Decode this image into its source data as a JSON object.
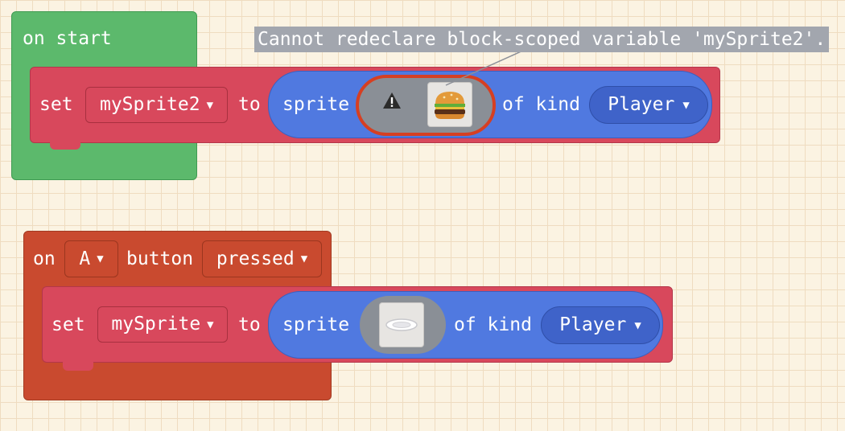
{
  "tooltip": {
    "text": "Cannot redeclare block-scoped variable 'mySprite2'."
  },
  "block_on_start": {
    "label": "on start",
    "set": {
      "keyword": "set",
      "variable": "mySprite2",
      "to": "to",
      "sprite": "sprite",
      "image_icon": "hamburger-sprite-icon",
      "warning_icon": "warning-icon",
      "of_kind": "of kind",
      "kind": "Player"
    }
  },
  "block_on_button": {
    "on": "on",
    "button": "A",
    "button_word": "button",
    "event": "pressed",
    "set": {
      "keyword": "set",
      "variable": "mySprite",
      "to": "to",
      "sprite": "sprite",
      "image_icon": "plate-sprite-icon",
      "of_kind": "of kind",
      "kind": "Player"
    }
  },
  "colors": {
    "on_start_green": "#5cb96c",
    "controller_orange": "#c94a2f",
    "variables_red": "#d8485c",
    "sprites_blue": "#5079e0",
    "error_outline": "#d63f22"
  },
  "caret": "▼"
}
